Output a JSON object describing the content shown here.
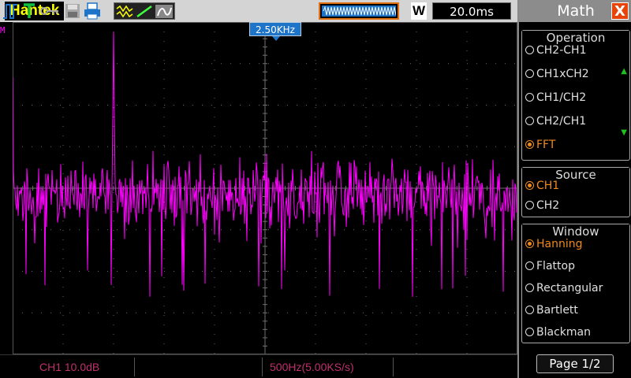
{
  "app": {
    "brand": "Hantek"
  },
  "toolbar": {
    "icons": [
      "acquire-wave-icon",
      "slope-icon",
      "persist-icon",
      "trigger-pulse-icon",
      "trigger-T-icon",
      "key-icon",
      "save-icon",
      "print-icon"
    ],
    "mode": "W",
    "timebase": "20.0ms"
  },
  "screen": {
    "marker": "2.50KHz",
    "ref_label": "M"
  },
  "status": {
    "ch1": "CH1 10.0dB",
    "time": "500Hz(5.00KS/s)"
  },
  "menu": {
    "title": "Math",
    "close": "X",
    "operation": {
      "legend": "Operation",
      "options": [
        "CH2-CH1",
        "CH1xCH2",
        "CH1/CH2",
        "CH2/CH1",
        "FFT"
      ],
      "selected": "FFT"
    },
    "source": {
      "legend": "Source",
      "options": [
        "CH1",
        "CH2"
      ],
      "selected": "CH1"
    },
    "window": {
      "legend": "Window",
      "options": [
        "Hanning",
        "Flattop",
        "Rectangular",
        "Bartlett",
        "Blackman"
      ],
      "selected": "Hanning"
    },
    "page": "Page 1/2"
  },
  "colors": {
    "trace": "#ff00ff",
    "brand": "#ffff00",
    "selected": "#f08a1c",
    "marker": "#1e74c8",
    "status_text": "#c0306a"
  },
  "fft": {
    "peak_freq_label": "2.50KHz",
    "peak_relative_height": 0.97
  }
}
